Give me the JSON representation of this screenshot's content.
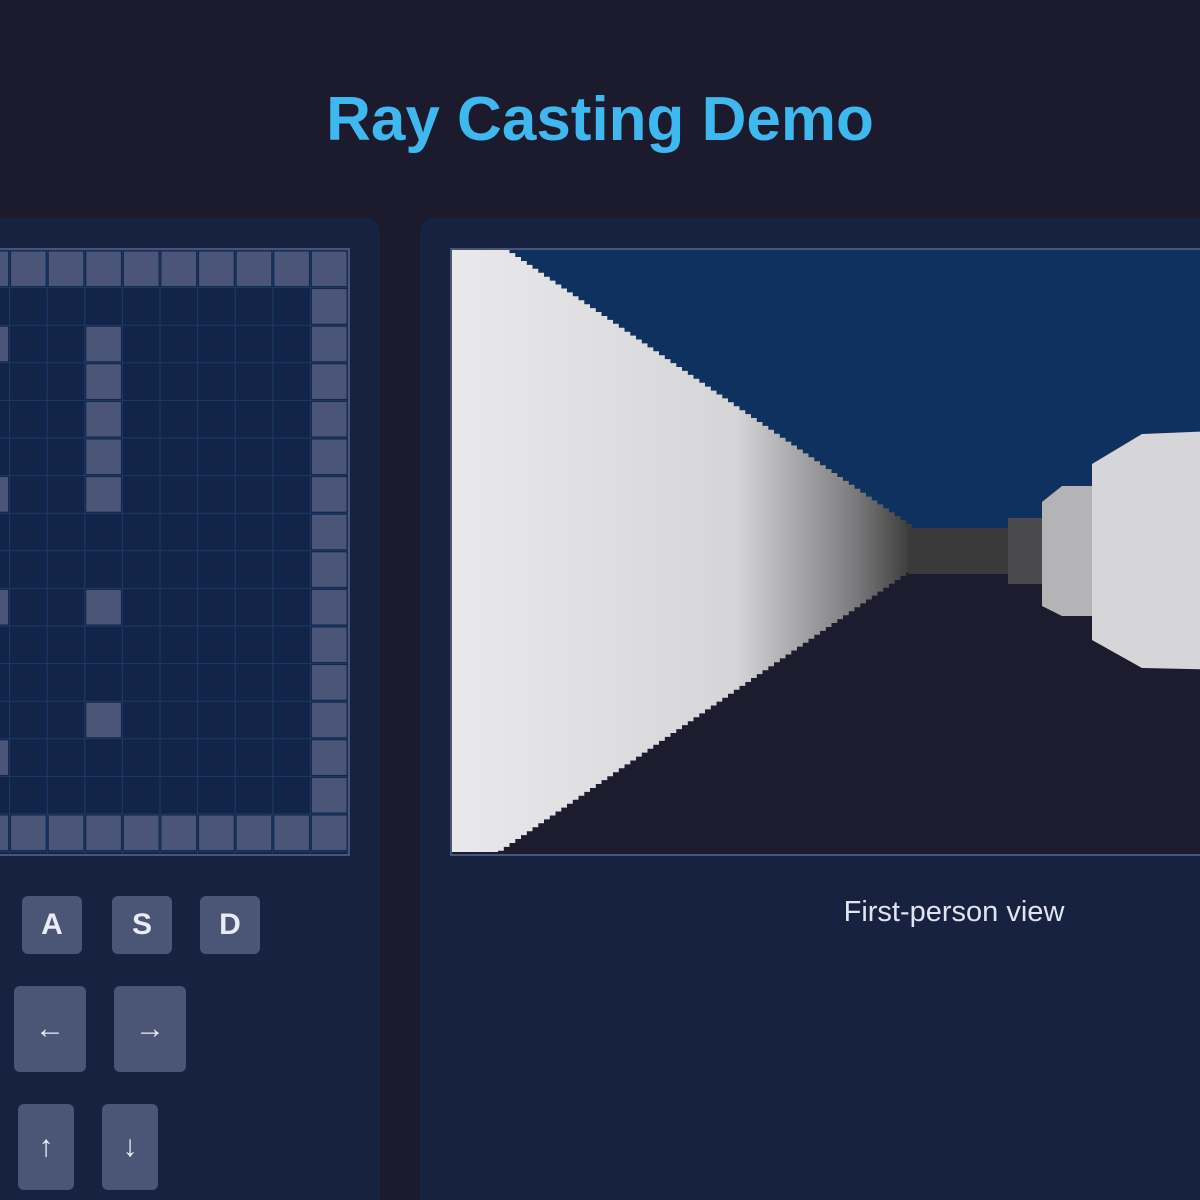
{
  "header": {
    "title": "Ray Casting Demo"
  },
  "colors": {
    "background": "#1c1b2e",
    "panel": "#172140",
    "title": "#3fb8ef",
    "wall_tile": "#4b5577",
    "floor_tile": "#122548",
    "grid_line": "#1c3a6a",
    "sky": "#0f3160",
    "floor": "#1d1b2e",
    "wall_near": "#e9e9ec",
    "wall_far": "#3a3a3a",
    "key": "#4b5575"
  },
  "map": {
    "cols": 10,
    "rows": 16,
    "walls": [
      [
        1,
        1,
        1,
        1,
        1,
        1,
        1,
        1,
        1,
        1
      ],
      [
        0,
        0,
        0,
        0,
        0,
        0,
        0,
        0,
        0,
        1
      ],
      [
        1,
        0,
        0,
        1,
        0,
        0,
        0,
        0,
        0,
        1
      ],
      [
        0,
        0,
        0,
        1,
        0,
        0,
        0,
        0,
        0,
        1
      ],
      [
        0,
        0,
        0,
        1,
        0,
        0,
        0,
        0,
        0,
        1
      ],
      [
        0,
        0,
        0,
        1,
        0,
        0,
        0,
        0,
        0,
        1
      ],
      [
        1,
        0,
        0,
        1,
        0,
        0,
        0,
        0,
        0,
        1
      ],
      [
        0,
        0,
        0,
        0,
        0,
        0,
        0,
        0,
        0,
        1
      ],
      [
        0,
        0,
        0,
        0,
        0,
        0,
        0,
        0,
        0,
        1
      ],
      [
        1,
        0,
        0,
        1,
        0,
        0,
        0,
        0,
        0,
        1
      ],
      [
        0,
        0,
        0,
        0,
        0,
        0,
        0,
        0,
        0,
        1
      ],
      [
        0,
        0,
        0,
        0,
        0,
        0,
        0,
        0,
        0,
        1
      ],
      [
        0,
        0,
        0,
        1,
        0,
        0,
        0,
        0,
        0,
        1
      ],
      [
        1,
        0,
        0,
        0,
        0,
        0,
        0,
        0,
        0,
        1
      ],
      [
        0,
        0,
        0,
        0,
        0,
        0,
        0,
        0,
        0,
        1
      ],
      [
        1,
        1,
        1,
        1,
        1,
        1,
        1,
        1,
        1,
        1
      ]
    ]
  },
  "controls": {
    "keys": [
      {
        "name": "key-a",
        "label": "A"
      },
      {
        "name": "key-s",
        "label": "S"
      },
      {
        "name": "key-d",
        "label": "D"
      }
    ],
    "turn_left": "←",
    "turn_right": "→",
    "up": "↑",
    "down": "↓"
  },
  "view": {
    "caption": "First-person view"
  }
}
